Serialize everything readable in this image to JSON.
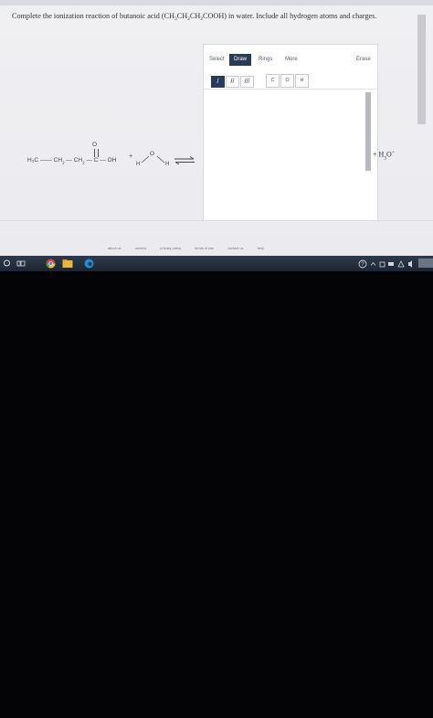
{
  "question": {
    "prefix": "Complete the ionization reaction of butanoic acid (CH",
    "s1": "3",
    "m1": "CH",
    "s2": "2",
    "m2": "CH",
    "s3": "2",
    "suffix": "COOH) in water. Include all hydrogen atoms and charges."
  },
  "reactant": {
    "h3c": "H₃C",
    "ch2a_main": "CH",
    "ch2a_sub": "2",
    "ch2b_main": "CH",
    "ch2b_sub": "2",
    "carbon": "C",
    "hydroxyl": "OH",
    "carbonyl_o": "O",
    "plus": "+",
    "water_o": "O",
    "water_h": "H"
  },
  "toolbar": {
    "tabs": [
      "Select",
      "Draw",
      "Rings",
      "More"
    ],
    "erase": "Erase",
    "bonds": [
      "/",
      "//",
      "///"
    ],
    "atoms": [
      "C",
      "O",
      "H"
    ]
  },
  "product": {
    "plus": "+",
    "main": "H",
    "sub": "3",
    "o": "O",
    "sup": "+"
  },
  "footer": [
    "about us",
    "careers",
    "privacy policy",
    "terms of use",
    "contact us",
    "help"
  ],
  "colors": {
    "accent_dark": "#2b3a57",
    "taskbar": "#1d2633",
    "page_bg": "#ededf1"
  }
}
